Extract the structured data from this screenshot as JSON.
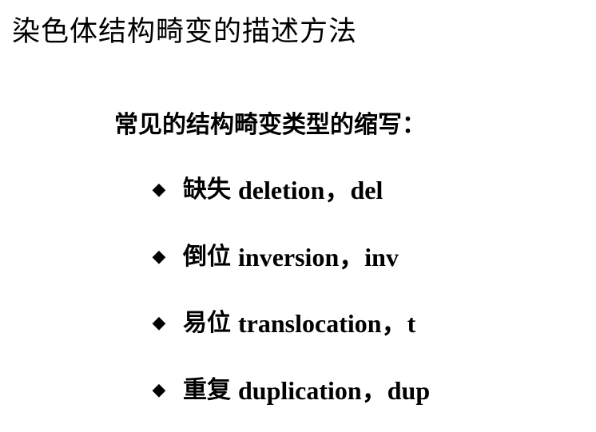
{
  "slide": {
    "title": "染色体结构畸变的描述方法",
    "subtitle": "常见的结构畸变类型的缩写：",
    "bullet_glyph": "◆",
    "items": [
      {
        "cn": "缺失",
        "en": "deletion",
        "sep": "，",
        "abbr": "del"
      },
      {
        "cn": "倒位",
        "en": "inversion",
        "sep": "，",
        "abbr": "inv"
      },
      {
        "cn": "易位",
        "en": "translocation",
        "sep": "，",
        "abbr": "t"
      },
      {
        "cn": "重复",
        "en": "duplication",
        "sep": "，",
        "abbr": "dup"
      }
    ]
  }
}
